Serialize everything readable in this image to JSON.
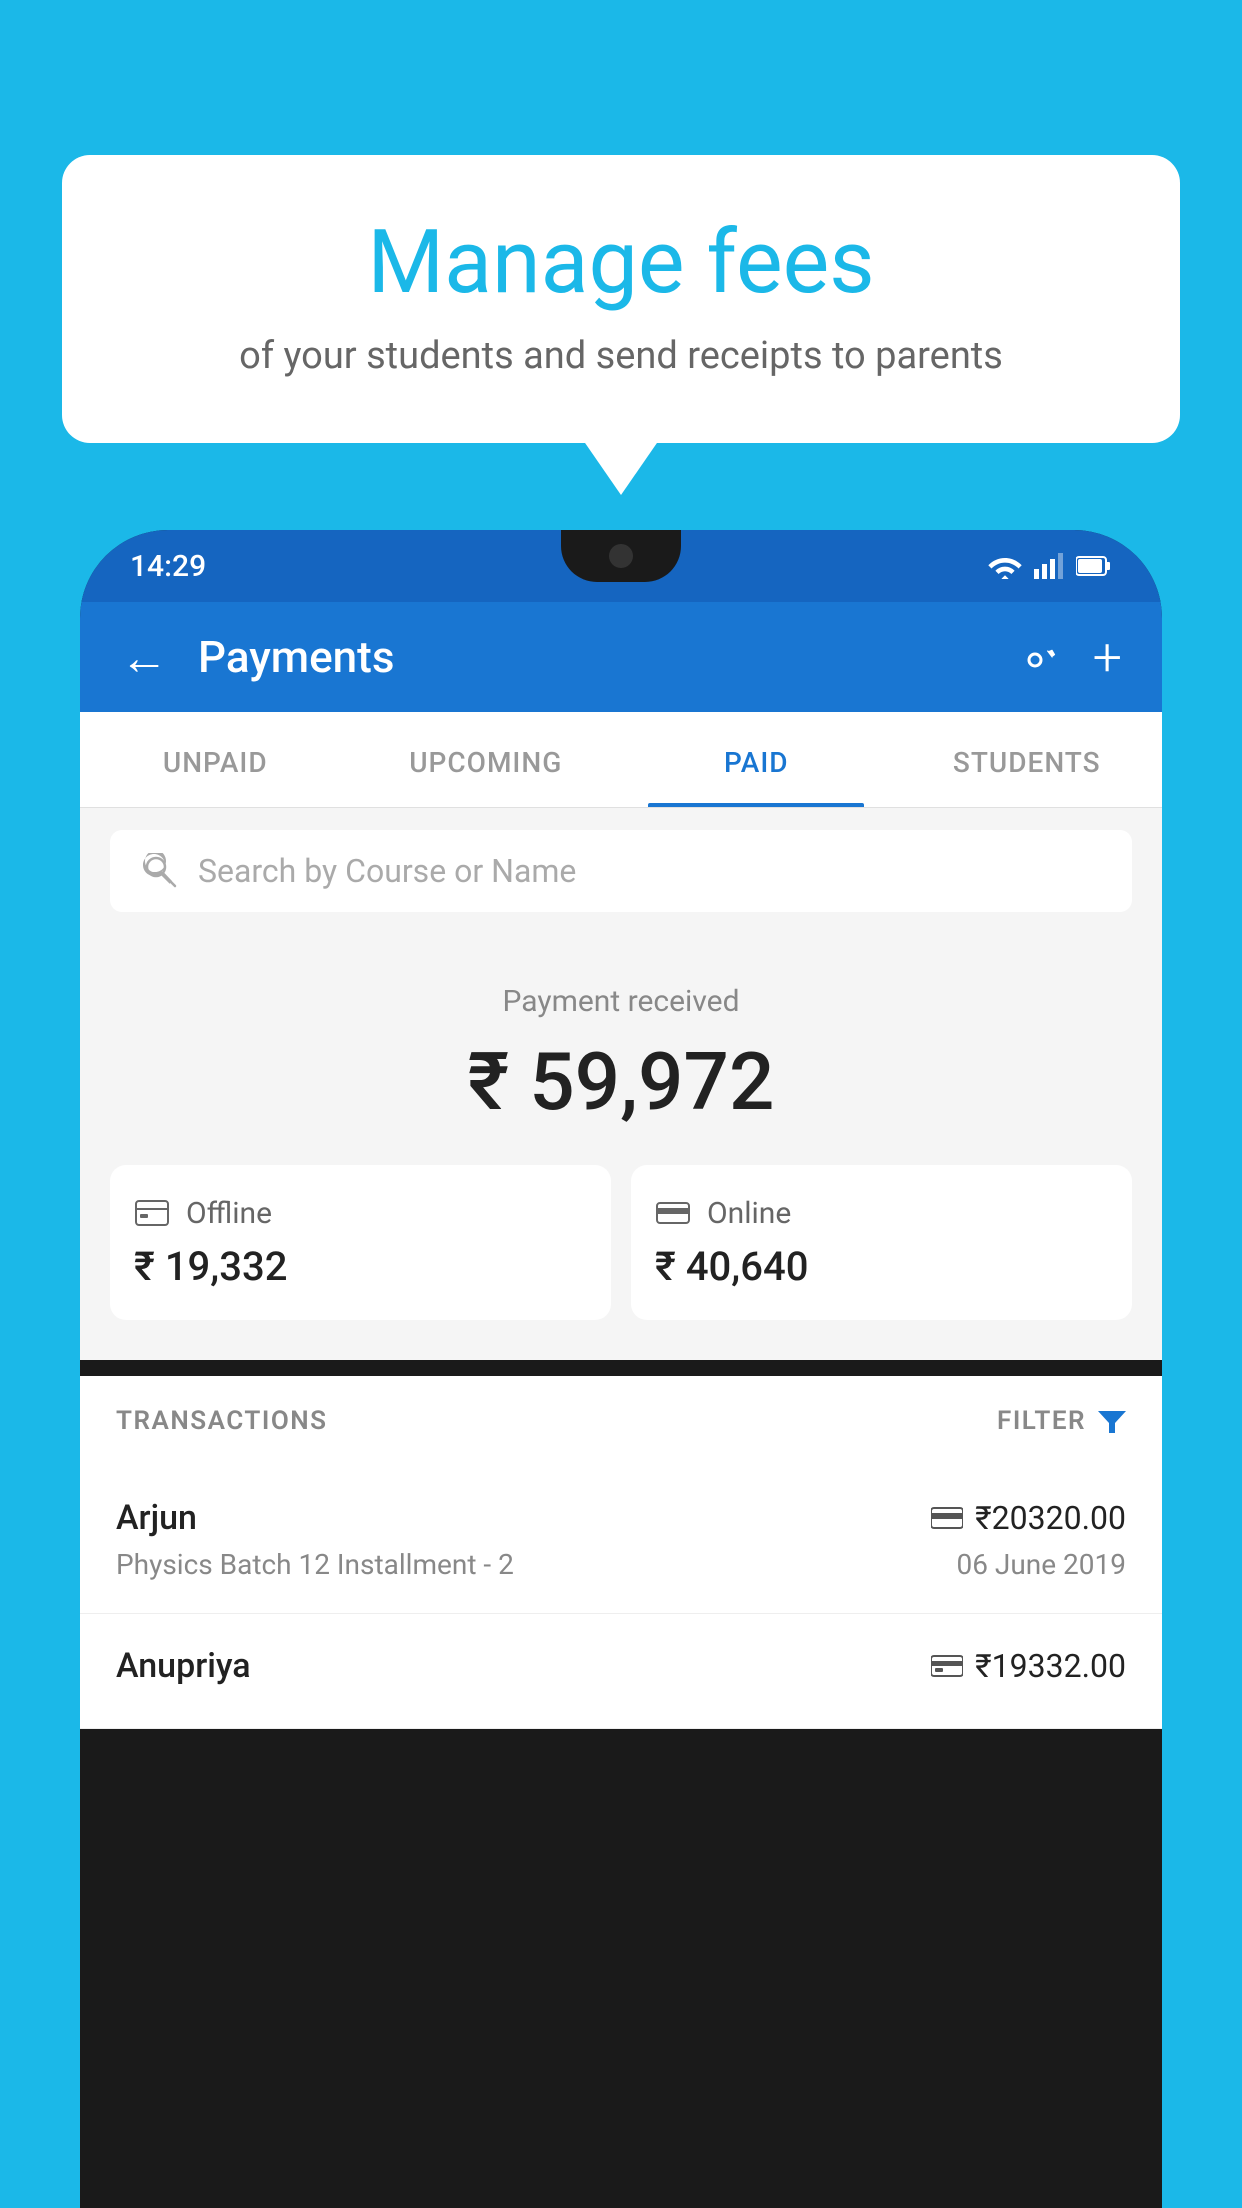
{
  "background_color": "#1BB8E8",
  "speech_bubble": {
    "title": "Manage fees",
    "subtitle": "of your students and send receipts to parents"
  },
  "status_bar": {
    "time": "14:29"
  },
  "header": {
    "title": "Payments",
    "back_label": "←",
    "settings_label": "⚙",
    "add_label": "+"
  },
  "tabs": [
    {
      "label": "UNPAID",
      "active": false
    },
    {
      "label": "UPCOMING",
      "active": false
    },
    {
      "label": "PAID",
      "active": true
    },
    {
      "label": "STUDENTS",
      "active": false
    }
  ],
  "search": {
    "placeholder": "Search by Course or Name"
  },
  "payment_section": {
    "received_label": "Payment received",
    "total_amount": "₹ 59,972",
    "offline_label": "Offline",
    "offline_amount": "₹ 19,332",
    "online_label": "Online",
    "online_amount": "₹ 40,640"
  },
  "transactions_header": {
    "label": "TRANSACTIONS",
    "filter_label": "FILTER"
  },
  "transactions": [
    {
      "name": "Arjun",
      "course": "Physics Batch 12 Installment - 2",
      "amount": "₹20320.00",
      "date": "06 June 2019",
      "type": "online"
    },
    {
      "name": "Anupriya",
      "course": "",
      "amount": "₹19332.00",
      "date": "",
      "type": "offline"
    }
  ]
}
